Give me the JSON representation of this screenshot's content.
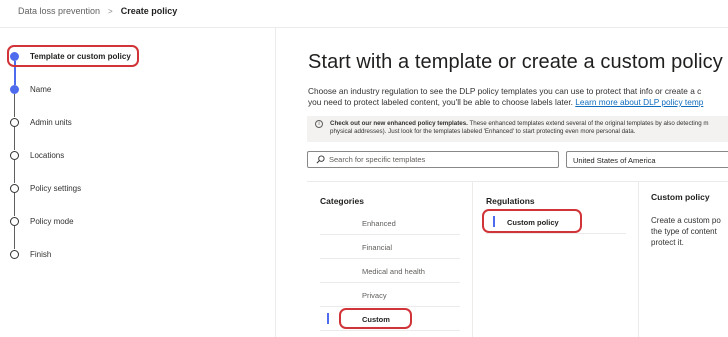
{
  "breadcrumb": {
    "parent": "Data loss prevention",
    "separator": ">",
    "current": "Create policy"
  },
  "steps": [
    {
      "label": "Template or custom policy",
      "state": "current"
    },
    {
      "label": "Name",
      "state": "active"
    },
    {
      "label": "Admin units",
      "state": "upcoming"
    },
    {
      "label": "Locations",
      "state": "upcoming"
    },
    {
      "label": "Policy settings",
      "state": "upcoming"
    },
    {
      "label": "Policy mode",
      "state": "upcoming"
    },
    {
      "label": "Finish",
      "state": "upcoming"
    }
  ],
  "main": {
    "title": "Start with a template or create a custom policy",
    "description_line1": "Choose an industry regulation to see the DLP policy templates you can use to protect that info or create a c",
    "description_line2": "you need to protect labeled content, you'll be able to choose labels later. ",
    "learn_more_link": "Learn more about DLP policy temp",
    "info_bold": "Check out our new enhanced policy templates.",
    "info_text": " These enhanced templates extend several of the original templates by also detecting m",
    "info_line2": "physical addresses). Just look for the templates labeled 'Enhanced' to start protecting even more personal data.",
    "search_placeholder": "Search for specific templates",
    "country_value": "United States of America"
  },
  "categories": {
    "header": "Categories",
    "items": [
      "Enhanced",
      "Financial",
      "Medical and health",
      "Privacy",
      "Custom"
    ],
    "selected": "Custom"
  },
  "regulations": {
    "header": "Regulations",
    "items": [
      "Custom policy"
    ],
    "selected": "Custom policy"
  },
  "custom_policy": {
    "header": "Custom policy",
    "line1": "Create a custom po",
    "line2": "the type of content",
    "line3": "protect it."
  },
  "colors": {
    "accent": "#4f6bed",
    "highlight": "#d13438",
    "link": "#0f6cbd"
  }
}
